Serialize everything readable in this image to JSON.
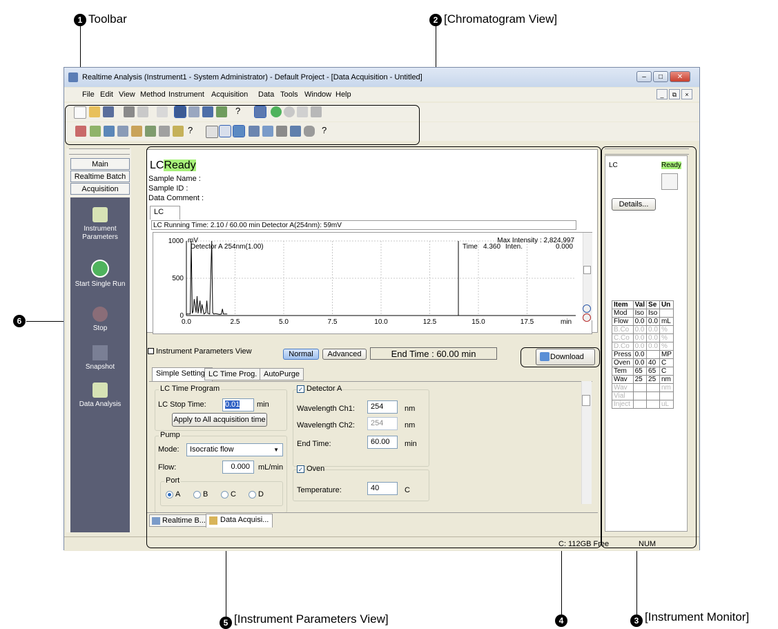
{
  "callouts": {
    "toolbar": {
      "num": "1",
      "label": "Toolbar"
    },
    "chromatogram": {
      "num": "2",
      "label": "[Chromatogram View]"
    },
    "monitor": {
      "num": "3",
      "label": "[Instrument Monitor]"
    },
    "download": {
      "num": "4"
    },
    "params": {
      "num": "5",
      "label": "[Instrument Parameters View]"
    },
    "divider": {
      "num": "6"
    }
  },
  "window": {
    "title": "Realtime Analysis (Instrument1 - System Administrator) - Default Project - [Data Acquisition - Untitled]",
    "min": "–",
    "max": "□",
    "close": "✕"
  },
  "menu": {
    "items": [
      "File",
      "Edit",
      "View",
      "Method",
      "Instrument",
      "Acquisition",
      "Data",
      "Tools",
      "Window",
      "Help"
    ],
    "mdi_min": "_",
    "mdi_restore": "⧉",
    "mdi_close": "×"
  },
  "toolbar_help": "?",
  "sidebar": {
    "tabs": [
      "Main",
      "Realtime Batch",
      "Acquisition"
    ],
    "buttons": [
      "Instrument Parameters",
      "Start Single Run",
      "Stop",
      "Snapshot",
      "Data Analysis"
    ]
  },
  "chrom": {
    "heading_prefix": "LC",
    "status": "Ready",
    "sample_name": "Sample Name :",
    "sample_id": "Sample ID :",
    "data_comment": "Data Comment :",
    "tab": "LC",
    "running": "LC Running Time: 2.10 / 60.00 min Detector A(254nm): 59mV",
    "max_intensity": "Max Intensity : 2,824,997",
    "detector_label": "Detector A 254nm(1.00)",
    "time_label": "Time",
    "time_value": "4.360",
    "inten_label": "Inten.",
    "inten_value": "0.000",
    "y_unit": "mV",
    "x_unit": "min"
  },
  "chart_data": {
    "type": "line",
    "series": [
      {
        "name": "Detector A 254nm(1.00)",
        "x": [
          0.0,
          0.2,
          0.25,
          0.3,
          0.35,
          0.4,
          0.5,
          0.55,
          0.6,
          0.7,
          0.75,
          0.8,
          0.9,
          1.0,
          1.05,
          1.1,
          1.2,
          1.3,
          1.35,
          1.4,
          1.5,
          1.6,
          1.7,
          1.8,
          1.85,
          1.9,
          2.1
        ],
        "y": [
          20,
          20,
          1000,
          30,
          60,
          220,
          40,
          260,
          30,
          200,
          30,
          150,
          20,
          40,
          200,
          30,
          20,
          1000,
          40,
          20,
          25,
          20,
          15,
          20,
          90,
          20,
          20
        ]
      }
    ],
    "x_ticks": [
      "0.0",
      "2.5",
      "5.0",
      "7.5",
      "10.0",
      "12.5",
      "15.0",
      "17.5"
    ],
    "y_ticks": [
      "0",
      "500",
      "1000"
    ],
    "xlim": [
      0,
      20
    ],
    "ylim": [
      0,
      1000
    ],
    "xlabel": "min",
    "ylabel": "mV",
    "grid": true
  },
  "params": {
    "title": "Instrument Parameters View",
    "normal": "Normal",
    "advanced": "Advanced",
    "end_time": "End Time : 60.00 min",
    "download": "Download",
    "tabs": [
      "Simple Settings",
      "LC Time Prog.",
      "AutoPurge"
    ],
    "lc_time_group": "LC Time Program",
    "lc_stop_label": "LC Stop Time:",
    "lc_stop_value": "0.01",
    "min_unit": "min",
    "apply_button": "Apply to All acquisition time",
    "pump_group": "Pump",
    "mode_label": "Mode:",
    "mode_value": "Isocratic flow",
    "flow_label": "Flow:",
    "flow_value": "0.000",
    "flow_unit": "mL/min",
    "port_group": "Port",
    "ports": [
      "A",
      "B",
      "C",
      "D"
    ],
    "detector_label": "Detector A",
    "wl1_label": "Wavelength Ch1:",
    "wl1_value": "254",
    "wl2_label": "Wavelength Ch2:",
    "wl2_value": "254",
    "nm": "nm",
    "end_label": "End Time:",
    "end_value": "60.00",
    "oven_label": "Oven",
    "temp_label": "Temperature:",
    "temp_value": "40",
    "temp_unit": "C",
    "check": "✓"
  },
  "doc_tabs": [
    "Realtime B...",
    "Data Acquisi..."
  ],
  "monitor": {
    "label": "LC",
    "status": "Ready",
    "details": "Details...",
    "table": [
      [
        "Item",
        "Val",
        "Se",
        "Un"
      ],
      [
        "Mod",
        "Iso",
        "Iso",
        ""
      ],
      [
        "Flow",
        "0.0",
        "0.0",
        "mL"
      ],
      [
        "B.Co",
        "0.0",
        "0.0",
        "%"
      ],
      [
        "C.Co",
        "0.0",
        "0.0",
        "%"
      ],
      [
        "D.Co",
        "0.0",
        "0.0",
        "%"
      ],
      [
        "Press",
        "0.0",
        "",
        "MP"
      ],
      [
        "Oven",
        "0.0",
        "40",
        "C"
      ],
      [
        "Tem",
        "65",
        "65",
        "C"
      ],
      [
        "Wav",
        "25",
        "25",
        "nm"
      ],
      [
        "Wav",
        "",
        "",
        "nm"
      ],
      [
        "Vial",
        "",
        "",
        ""
      ],
      [
        "Inject",
        "",
        "",
        "uL"
      ]
    ]
  },
  "status": {
    "disk": "C: 112GB Free",
    "num": "NUM"
  }
}
